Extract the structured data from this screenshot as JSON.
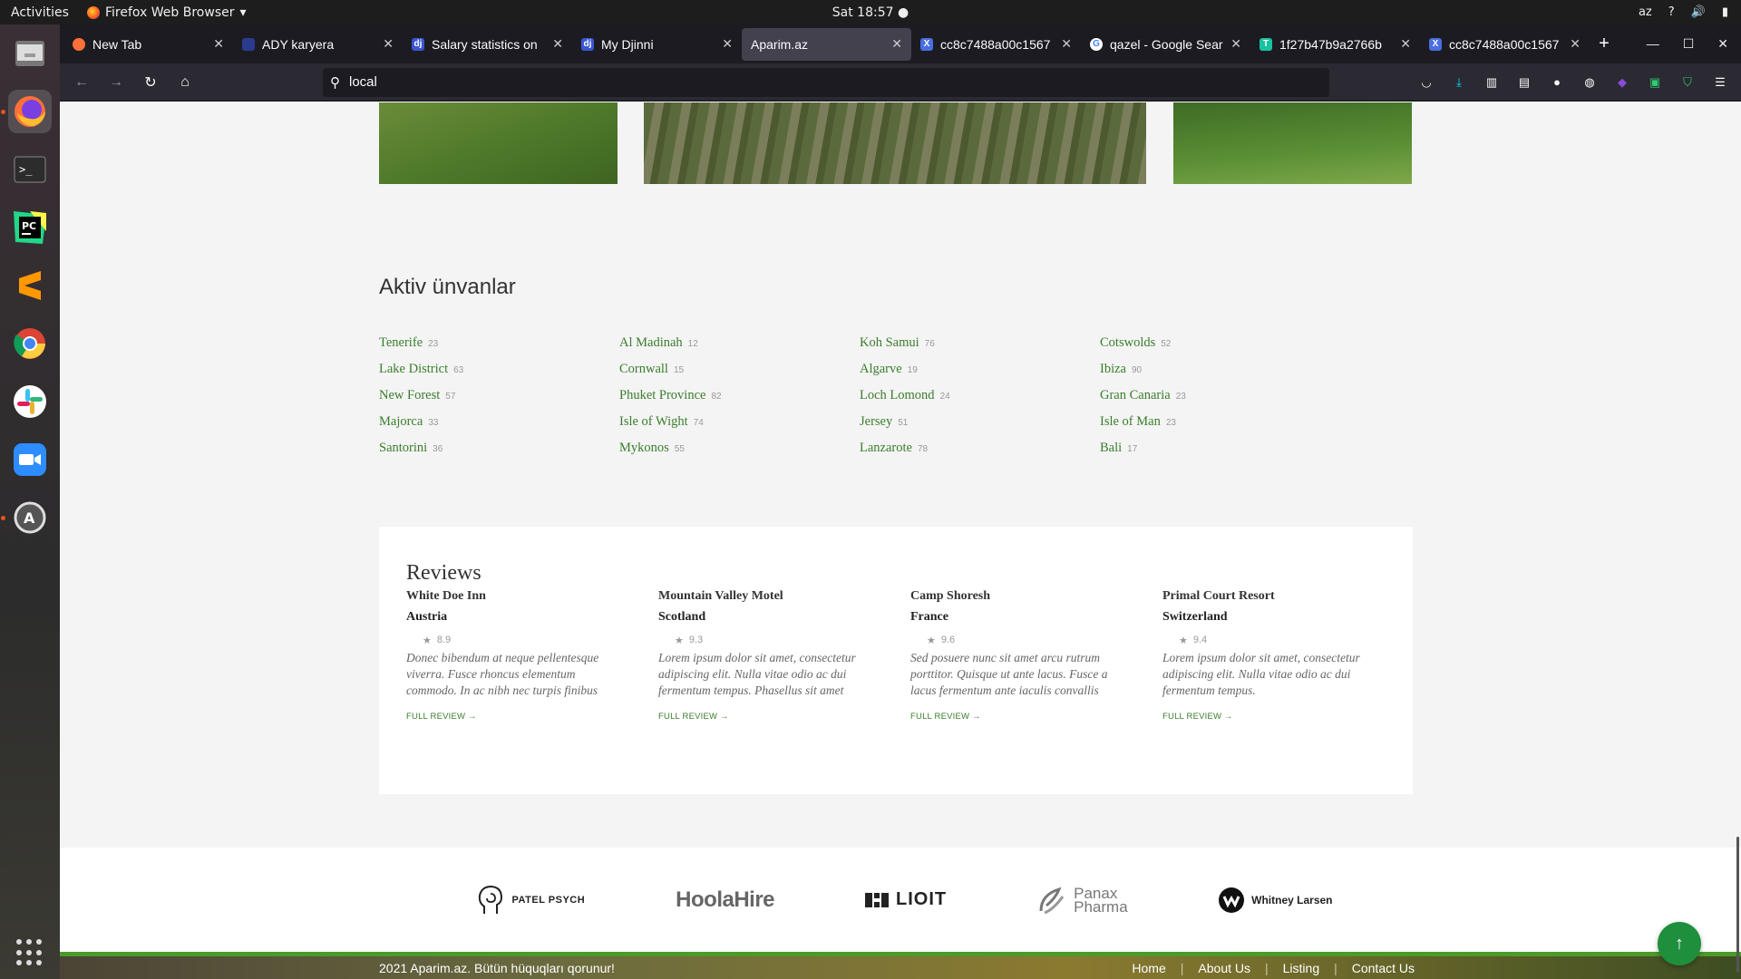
{
  "system": {
    "activities": "Activities",
    "app_name": "Firefox Web Browser",
    "clock": "Sat 18:57",
    "lang": "az"
  },
  "dock": [
    "files",
    "firefox",
    "terminal",
    "pycharm",
    "sublime",
    "chrome",
    "slack",
    "zoom",
    "software-updater"
  ],
  "tabs": [
    {
      "title": "New Tab",
      "icon": "firefox-icon",
      "color": "#ff7139"
    },
    {
      "title": "ADY karyera",
      "icon": "ady-icon",
      "color": "#2a3b8f"
    },
    {
      "title": "Salary statistics on",
      "icon": "djinni-icon",
      "color": "#3a56d0"
    },
    {
      "title": "My Djinni",
      "icon": "djinni-icon",
      "color": "#3a56d0"
    },
    {
      "title": "Aparim.az",
      "icon": "",
      "color": "",
      "active": true
    },
    {
      "title": "cc8c7488a00c1567",
      "icon": "x-icon",
      "color": "#4a6ee0"
    },
    {
      "title": "qazel - Google Sear",
      "icon": "google-icon",
      "color": "#ffffff"
    },
    {
      "title": "1f27b47b9a2766b",
      "icon": "t-icon",
      "color": "#19c3a0"
    },
    {
      "title": "cc8c7488a00c1567",
      "icon": "x-icon",
      "color": "#4a6ee0"
    }
  ],
  "url": "local",
  "page": {
    "section_title": "Aktiv ünvanlar",
    "destinations": [
      {
        "name": "Tenerife",
        "count": "23"
      },
      {
        "name": "Al Madinah",
        "count": "12"
      },
      {
        "name": "Koh Samui",
        "count": "76"
      },
      {
        "name": "Cotswolds",
        "count": "52"
      },
      {
        "name": "Lake District",
        "count": "63"
      },
      {
        "name": "Cornwall",
        "count": "15"
      },
      {
        "name": "Algarve",
        "count": "19"
      },
      {
        "name": "Ibiza",
        "count": "90"
      },
      {
        "name": "New Forest",
        "count": "57"
      },
      {
        "name": "Phuket Province",
        "count": "82"
      },
      {
        "name": "Loch Lomond",
        "count": "24"
      },
      {
        "name": "Gran Canaria",
        "count": "23"
      },
      {
        "name": "Majorca",
        "count": "33"
      },
      {
        "name": "Isle of Wight",
        "count": "74"
      },
      {
        "name": "Jersey",
        "count": "51"
      },
      {
        "name": "Isle of Man",
        "count": "23"
      },
      {
        "name": "Santorini",
        "count": "36"
      },
      {
        "name": "Mykonos",
        "count": "55"
      },
      {
        "name": "Lanzarote",
        "count": "78"
      },
      {
        "name": "Bali",
        "count": "17"
      }
    ],
    "reviews_title": "Reviews",
    "reviews": [
      {
        "name": "White Doe Inn",
        "country": "Austria",
        "rating": "8.9",
        "text": "Donec bibendum at neque pellentesque viverra. Fusce rhoncus elementum commodo. In ac nibh nec turpis finibus",
        "link": "FULL REVIEW"
      },
      {
        "name": "Mountain Valley Motel",
        "country": "Scotland",
        "rating": "9.3",
        "text": "Lorem ipsum dolor sit amet, consectetur adipiscing elit. Nulla vitae odio ac dui fermentum tempus. Phasellus sit amet",
        "link": "FULL REVIEW"
      },
      {
        "name": "Camp Shoresh",
        "country": "France",
        "rating": "9.6",
        "text": "Sed posuere nunc sit amet arcu rutrum porttitor. Quisque ut ante lacus. Fusce a lacus fermentum ante iaculis convallis",
        "link": "FULL REVIEW"
      },
      {
        "name": "Primal Court Resort",
        "country": "Switzerland",
        "rating": "9.4",
        "text": "Lorem ipsum dolor sit amet, consectetur adipiscing elit. Nulla vitae odio ac dui fermentum tempus.",
        "link": "FULL REVIEW"
      }
    ],
    "partners": [
      {
        "name": "PATEL PSYCH"
      },
      {
        "name": "HoolaHire"
      },
      {
        "name": "LIOIT"
      },
      {
        "name": "Panax Pharma"
      },
      {
        "name": "Whitney Larsen"
      }
    ],
    "footer": {
      "copyright": "2021 Aparim.az. Bütün hüquqları qorunur!",
      "links": [
        "Home",
        "About Us",
        "Listing",
        "Contact Us"
      ]
    }
  },
  "colors": {
    "accent": "#3a7d2c",
    "totop": "#1e8f3c"
  }
}
